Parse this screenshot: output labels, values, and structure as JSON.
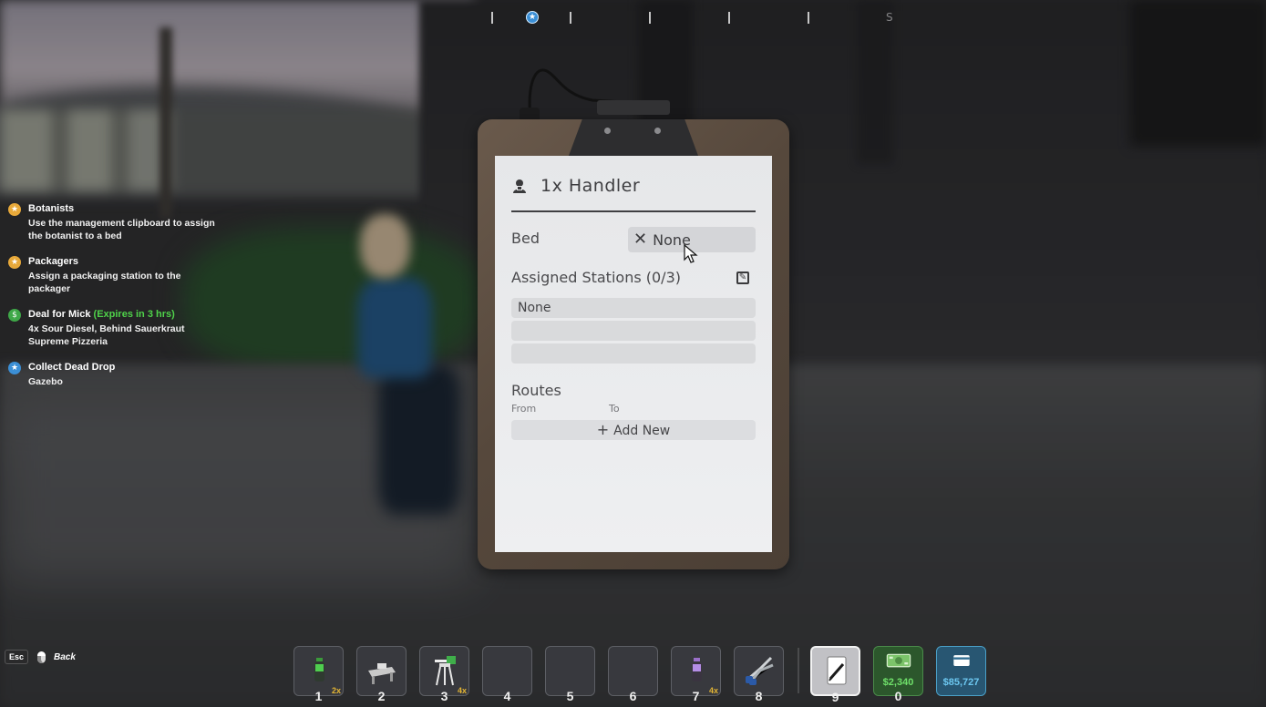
{
  "compass": {
    "marker_icon": "star-icon",
    "direction_label": "S"
  },
  "quests": [
    {
      "icon": "star-icon",
      "icon_color": "#e8a93a",
      "title": "Botanists",
      "expires": "",
      "description": "Use the management clipboard to assign the botanist to a bed"
    },
    {
      "icon": "star-icon",
      "icon_color": "#e8a93a",
      "title": "Packagers",
      "expires": "",
      "description": "Assign a packaging station to the packager"
    },
    {
      "icon": "deal-icon",
      "icon_color": "#3fa848",
      "title": "Deal for Mick",
      "expires": "(Expires in 3 hrs)",
      "description": "4x Sour Diesel, Behind Sauerkraut Supreme Pizzeria"
    },
    {
      "icon": "star-icon",
      "icon_color": "#3b8fd6",
      "title": "Collect Dead Drop",
      "expires": "",
      "description": "Gazebo"
    }
  ],
  "back_hint": {
    "key": "Esc",
    "label": "Back"
  },
  "clipboard": {
    "title": "1x Handler",
    "bed_label": "Bed",
    "bed_value": "None",
    "stations_label": "Assigned Stations (0/3)",
    "stations": [
      "None",
      "",
      ""
    ],
    "routes_label": "Routes",
    "routes_from": "From",
    "routes_to": "To",
    "add_new_label": "Add New"
  },
  "hotbar": {
    "slots": [
      {
        "number": "1",
        "item": "plant-bottle-icon",
        "qty": "2x"
      },
      {
        "number": "2",
        "item": "packaging-station-icon",
        "qty": ""
      },
      {
        "number": "3",
        "item": "grow-light-stand-icon",
        "qty": "4x"
      },
      {
        "number": "4",
        "item": "",
        "qty": ""
      },
      {
        "number": "5",
        "item": "",
        "qty": ""
      },
      {
        "number": "6",
        "item": "",
        "qty": ""
      },
      {
        "number": "7",
        "item": "purple-bottle-icon",
        "qty": "4x"
      },
      {
        "number": "8",
        "item": "trimmers-icon",
        "qty": ""
      },
      {
        "number": "9",
        "item": "clipboard-pen-icon",
        "qty": ""
      },
      {
        "number": "0",
        "item": "cash-icon",
        "qty": ""
      }
    ],
    "cash_amount": "$2,340",
    "card_amount": "$85,727",
    "cash_color": "#6fe06a",
    "card_color": "#6cc7f0"
  }
}
